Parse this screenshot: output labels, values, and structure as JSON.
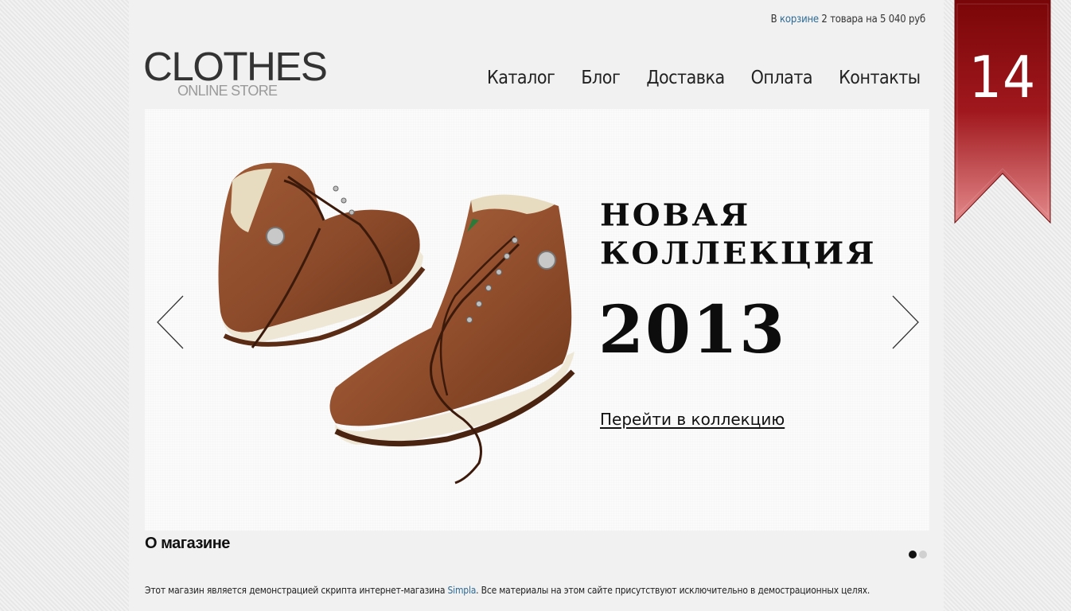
{
  "header": {
    "cart": {
      "prefix": "В ",
      "link": "корзине",
      "suffix": " 2 товара на 5 040 руб"
    },
    "logo": {
      "title": "CLOTHES",
      "subtitle": "ONLINE STORE"
    },
    "nav": [
      "Каталог",
      "Блог",
      "Доставка",
      "Оплата",
      "Контакты"
    ]
  },
  "slider": {
    "headline_line1": "НОВАЯ",
    "headline_line2": "КОЛЛЕКЦИЯ",
    "year": "2013",
    "link": "Перейти в коллекцию",
    "image": "brown-leather-boots",
    "active_slide": 1,
    "slide_count": 2
  },
  "about": {
    "title": "О магазине",
    "text_before": "Этот магазин является демонстрацией скрипта интернет-магазина ",
    "link": "Simpla",
    "text_after": ". Все материалы на этом сайте присутствуют исключительно в демострационных целях."
  },
  "ribbon": {
    "number": "14",
    "color": "#8c0f12"
  },
  "colors": {
    "link": "#2e6a93",
    "ribbon_dark": "#8c0f12"
  }
}
